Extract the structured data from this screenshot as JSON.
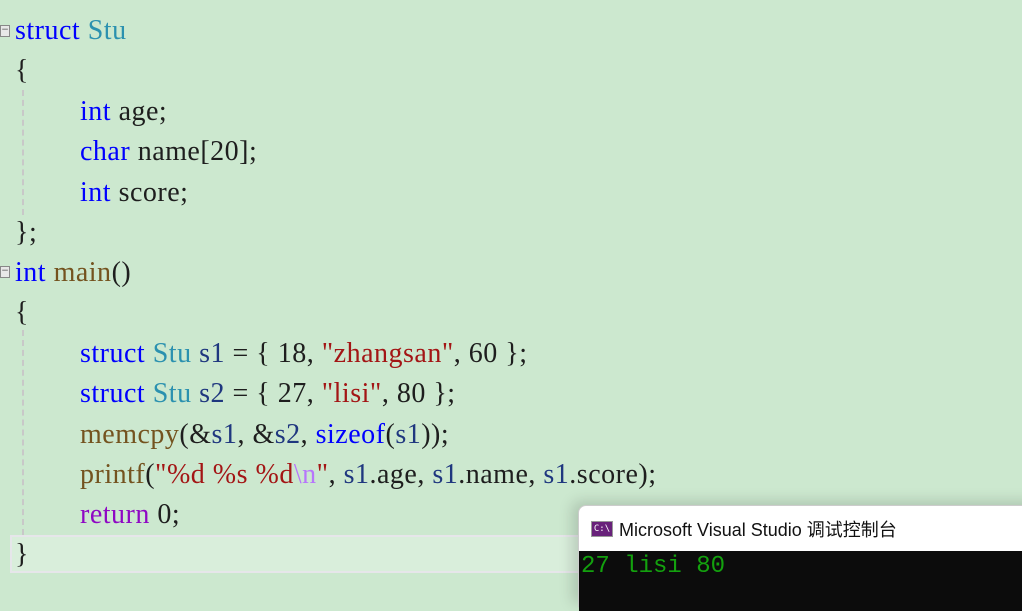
{
  "code": {
    "l1": {
      "kw": "struct",
      "ty": "Stu"
    },
    "l2": "{",
    "l3": {
      "kw": "int",
      "rest": "age;"
    },
    "l4": {
      "kw": "char",
      "rest": "name[20];"
    },
    "l5": {
      "kw": "int",
      "rest": "score;"
    },
    "l6": "};",
    "l7": {
      "kw": "int",
      "fn": "main",
      "rest": "()"
    },
    "l8": "{",
    "l9": {
      "kw": "struct",
      "ty": "Stu",
      "var": "s1",
      "p1": " = { 18, ",
      "str": "\"zhangsan\"",
      "p2": ", 60 };"
    },
    "l10": {
      "kw": "struct",
      "ty": "Stu",
      "var": "s2",
      "p1": " = { 27, ",
      "str": "\"lisi\"",
      "p2": ", 80 };"
    },
    "l11": {
      "fn": "memcpy",
      "p1": "(&",
      "v1": "s1",
      "p2": ", &",
      "v2": "s2",
      "p3": ", ",
      "kw": "sizeof",
      "p4": "(",
      "v3": "s1",
      "p5": "));"
    },
    "l12": {
      "fn": "printf",
      "p1": "(",
      "str1": "\"%d %s %d",
      "esc": "\\n",
      "str2": "\"",
      "p2": ", ",
      "v1": "s1",
      "f1": ".age, ",
      "v2": "s1",
      "f2": ".name, ",
      "v3": "s1",
      "f3": ".score);"
    },
    "l13": {
      "kw": "return",
      "rest": " 0;"
    },
    "l14": "}"
  },
  "console": {
    "icon": "C:\\",
    "title": "Microsoft Visual Studio 调试控制台",
    "output": "27 lisi 80"
  }
}
